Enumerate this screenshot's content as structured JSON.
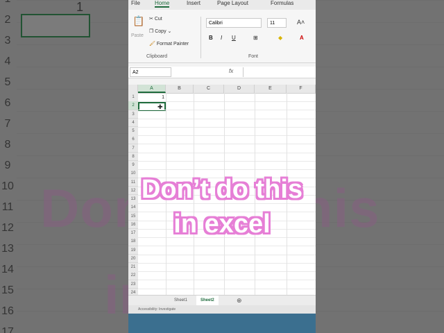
{
  "menu": {
    "items": [
      "File",
      "Home",
      "Insert",
      "Page Layout",
      "Formulas"
    ],
    "active": "Home"
  },
  "clipboard": {
    "paste": "Paste",
    "cut": "Cut",
    "copy": "Copy",
    "format_painter": "Format Painter",
    "group_label": "Clipboard"
  },
  "font": {
    "name": "Calibri",
    "size": "11",
    "group_label": "Font",
    "bold": "B",
    "italic": "I",
    "underline": "U",
    "font_color_label": "A"
  },
  "name_box": "A2",
  "formula_fx": "fx",
  "columns": [
    "A",
    "B",
    "C",
    "D",
    "E",
    "F"
  ],
  "rows": [
    "1",
    "2",
    "3",
    "4",
    "5",
    "6",
    "7",
    "8",
    "9",
    "10",
    "11",
    "12",
    "13",
    "14",
    "15",
    "16",
    "17",
    "18",
    "19",
    "20",
    "21",
    "22",
    "23",
    "24"
  ],
  "cell_a1_value": "1",
  "sheets": [
    "Sheet1",
    "Sheet2"
  ],
  "active_sheet": "Sheet2",
  "status_text": "Accessibility: Investigate",
  "background": {
    "rownums": [
      "1",
      "2",
      "3",
      "4",
      "5",
      "6",
      "7",
      "8",
      "9",
      "10",
      "11",
      "12",
      "13",
      "14",
      "15",
      "16",
      "17"
    ],
    "cell_value": "1"
  },
  "caption": {
    "line1": "Don’t do this",
    "line2": "in excel"
  },
  "colors": {
    "excel_green": "#1e6b3c",
    "caption_outline": "#e67fd6"
  }
}
